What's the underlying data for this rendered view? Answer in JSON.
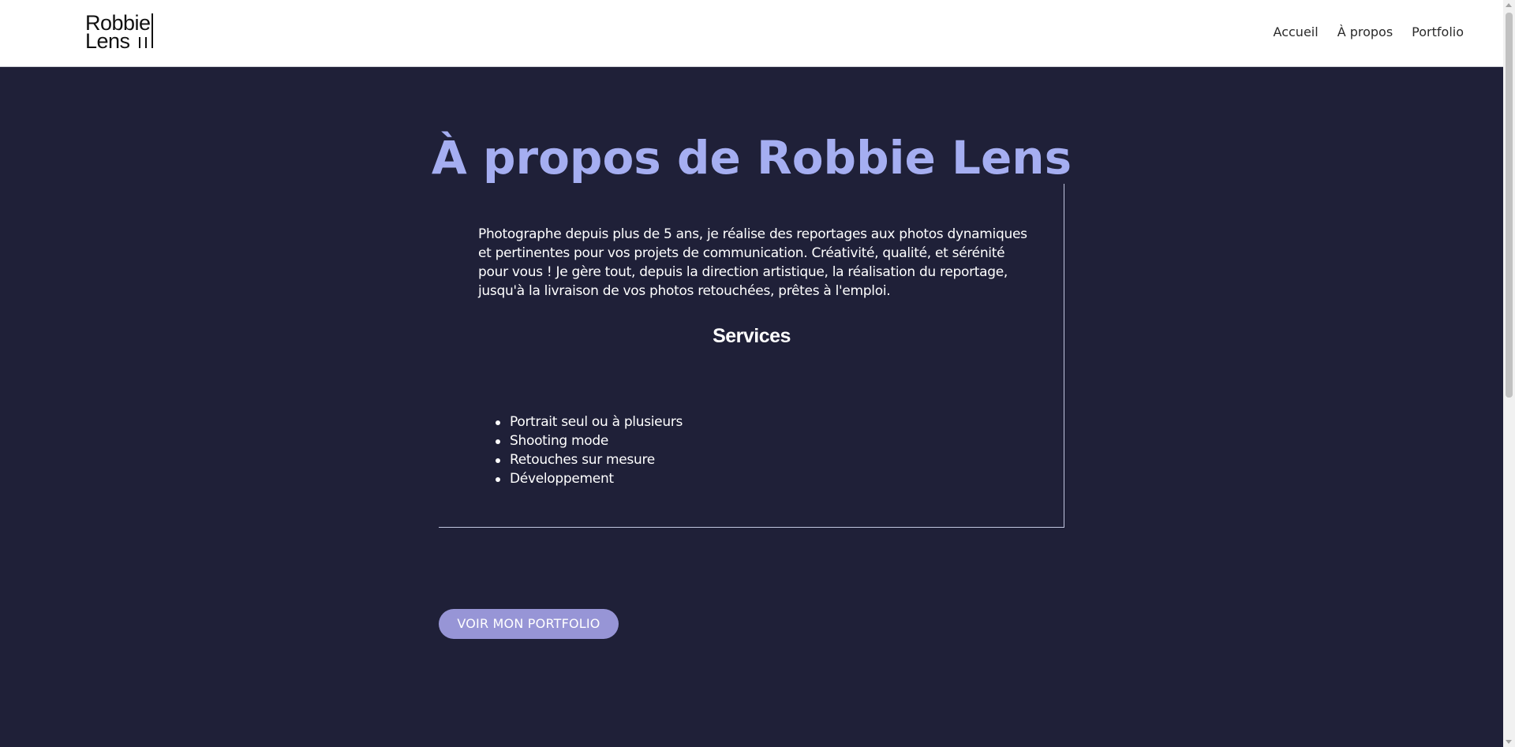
{
  "header": {
    "logo_line1": "Robbie",
    "logo_line2": "Lens",
    "nav": [
      {
        "label": "Accueil"
      },
      {
        "label": "À propos"
      },
      {
        "label": "Portfolio"
      }
    ]
  },
  "main": {
    "title": "À propos de Robbie Lens",
    "intro": "Photographe depuis plus de 5 ans, je réalise des reportages aux photos dynamiques et pertinentes pour vos projets de communication. Créativité, qualité, et sérénité pour vous ! Je gère tout, depuis la direction artistique, la réalisation du reportage, jusqu'à la livraison de vos photos retouchées, prêtes à l'emploi.",
    "services_title": "Services",
    "services": [
      "Portrait seul ou à plusieurs",
      "Shooting mode",
      "Retouches sur mesure",
      "Développement"
    ],
    "cta_label": "VOIR MON PORTFOLIO"
  },
  "colors": {
    "background": "#1f2038",
    "title_accent": "#a5aef1",
    "button": "#9795d6",
    "header_bg": "#ffffff"
  }
}
